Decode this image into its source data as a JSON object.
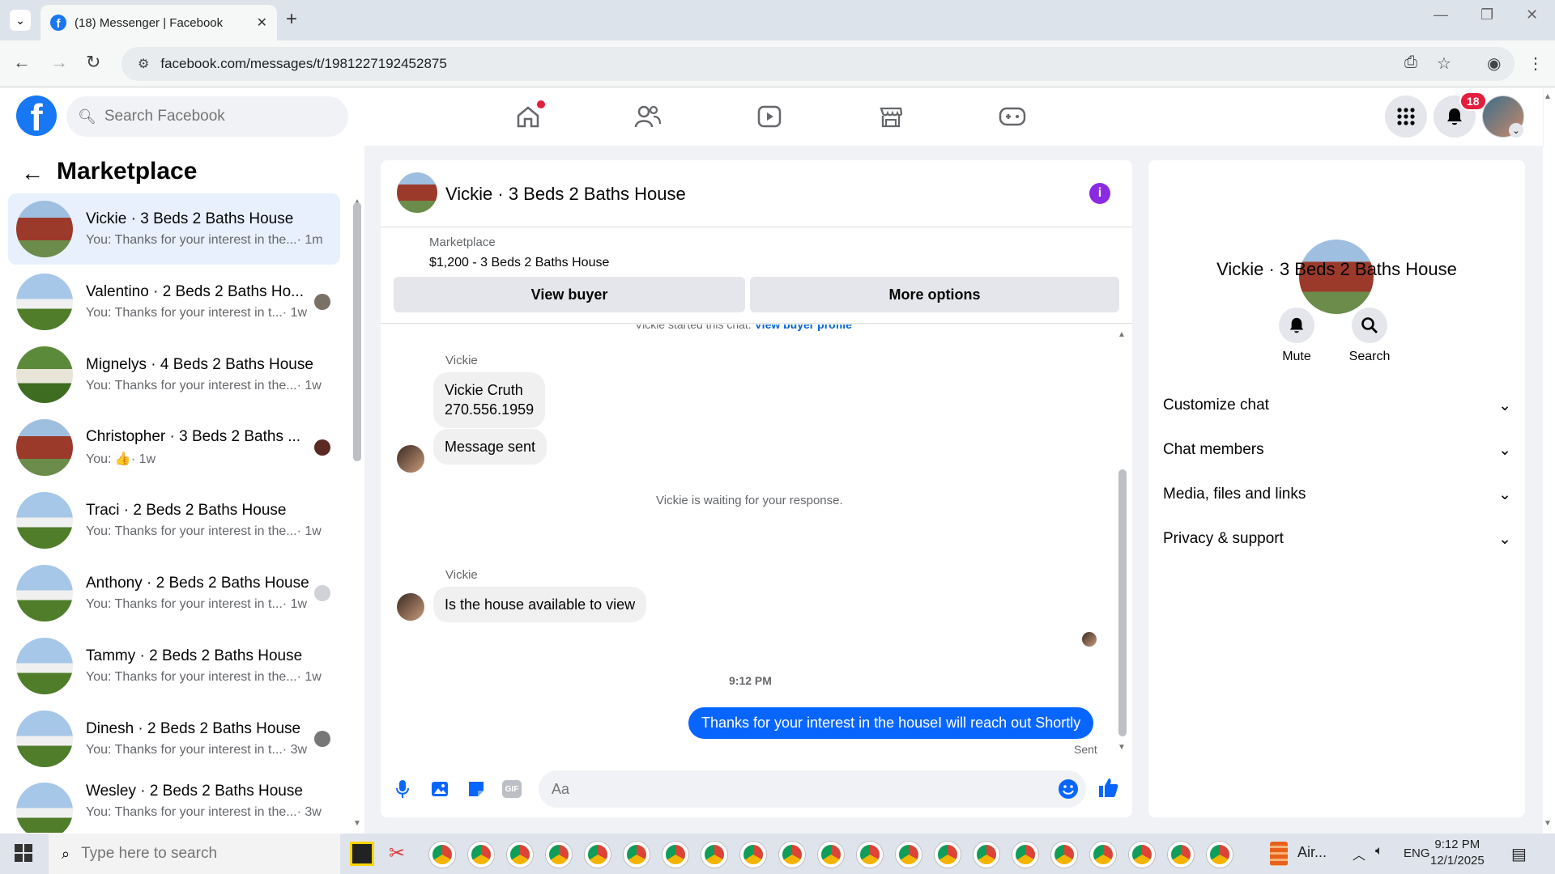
{
  "browser": {
    "tab_title": "(18) Messenger | Facebook",
    "url": "facebook.com/messages/t/1981227192452875"
  },
  "fb": {
    "search_placeholder": "Search Facebook",
    "notification_count": "18"
  },
  "sidebar": {
    "title": "Marketplace",
    "conversations": [
      {
        "name": "Vickie · 3 Beds 2 Baths House",
        "preview": "You: Thanks for your interest in the...",
        "time": "· 1m",
        "active": true
      },
      {
        "name": "Valentino · 2 Beds 2 Baths Ho...",
        "preview": "You: Thanks for your interest in t...",
        "time": "· 1w"
      },
      {
        "name": "Mignelys · 4 Beds 2 Baths House",
        "preview": "You: Thanks for your interest in the...",
        "time": "· 1w"
      },
      {
        "name": "Christopher · 3 Beds 2 Baths ...",
        "preview": "You: 👍",
        "time": "· 1w"
      },
      {
        "name": "Traci · 2 Beds 2 Baths House",
        "preview": "You: Thanks for your interest in the...",
        "time": "· 1w"
      },
      {
        "name": "Anthony · 2 Beds 2 Baths House",
        "preview": "You: Thanks for your interest in t...",
        "time": "· 1w"
      },
      {
        "name": "Tammy · 2 Beds 2 Baths House",
        "preview": "You: Thanks for your interest in the...",
        "time": "· 1w"
      },
      {
        "name": "Dinesh · 2 Beds 2 Baths House",
        "preview": "You: Thanks for your interest in t...",
        "time": "· 3w"
      },
      {
        "name": "Wesley · 2 Beds 2 Baths House",
        "preview": "You: Thanks for your interest in the...",
        "time": "· 3w"
      }
    ]
  },
  "chat": {
    "title": "Vickie · 3 Beds 2 Baths House",
    "marketplace_label": "Marketplace",
    "listing": "$1,200 - 3 Beds 2 Baths House",
    "view_buyer": "View buyer",
    "more_options": "More options",
    "started_text": "Vickie started this chat.",
    "view_profile": "View buyer profile",
    "sender": "Vickie",
    "msg1_line1": "Vickie Cruth",
    "msg1_line2": "270.556.1959",
    "msg2": "Message sent",
    "waiting": "Vickie is waiting for your response.",
    "msg3": "Is the house available to view",
    "time": "9:12 PM",
    "outgoing": "Thanks for your interest in the houseI will reach out Shortly",
    "sent": "Sent",
    "composer_placeholder": "Aa"
  },
  "info": {
    "name": "Vickie · 3 Beds 2 Baths House",
    "mute": "Mute",
    "search": "Search",
    "sections": [
      "Customize chat",
      "Chat members",
      "Media, files and links",
      "Privacy & support"
    ]
  },
  "taskbar": {
    "search_placeholder": "Type here to search",
    "app_label": "Air...",
    "lang": "ENG",
    "time": "9:12 PM",
    "date": "12/1/2025"
  },
  "colors": {
    "fb_blue": "#1877f2",
    "messenger_blue": "#0866ff",
    "badge_red": "#e41e3f"
  }
}
